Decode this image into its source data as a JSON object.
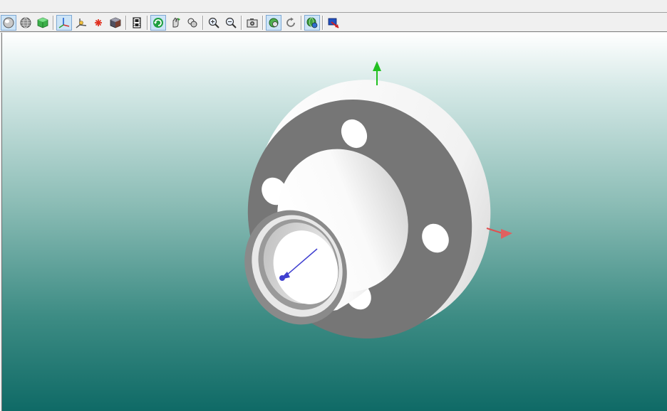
{
  "window": {
    "title": ""
  },
  "toolbar": {
    "buttons": [
      {
        "id": "shaded",
        "icon": "sphere-shaded-icon",
        "active": true
      },
      {
        "id": "wireframe",
        "icon": "sphere-wireframe-icon",
        "active": false
      },
      {
        "id": "box",
        "icon": "cube-icon",
        "active": false
      },
      {
        "id": "axes",
        "icon": "axes-icon",
        "active": true
      },
      {
        "id": "axes-alt",
        "icon": "axes-alt-icon",
        "active": false
      },
      {
        "id": "light",
        "icon": "light-star-icon",
        "active": false
      },
      {
        "id": "material",
        "icon": "material-cube-icon",
        "active": false
      },
      {
        "id": "film",
        "icon": "film-icon",
        "active": false
      },
      {
        "id": "rotate",
        "icon": "rotate-icon",
        "active": true
      },
      {
        "id": "pan",
        "icon": "pan-hand-icon",
        "active": false
      },
      {
        "id": "pan-alt",
        "icon": "pan-alt-icon",
        "active": false
      },
      {
        "id": "zoom-in",
        "icon": "zoom-in-icon",
        "active": false
      },
      {
        "id": "zoom-out",
        "icon": "zoom-out-icon",
        "active": false
      },
      {
        "id": "snapshot",
        "icon": "camera-icon",
        "active": false
      },
      {
        "id": "view-fit",
        "icon": "view-fit-icon",
        "active": true
      },
      {
        "id": "reset",
        "icon": "reset-icon",
        "active": false
      },
      {
        "id": "settings",
        "icon": "settings-globe-icon",
        "active": true
      },
      {
        "id": "export",
        "icon": "export-icon",
        "active": false
      }
    ]
  },
  "scene": {
    "axis_colors": {
      "x": "#e05050",
      "y": "#20c020",
      "z": "#4040d0"
    },
    "part_color": "#ffffff",
    "shadow_color": "#767676"
  }
}
